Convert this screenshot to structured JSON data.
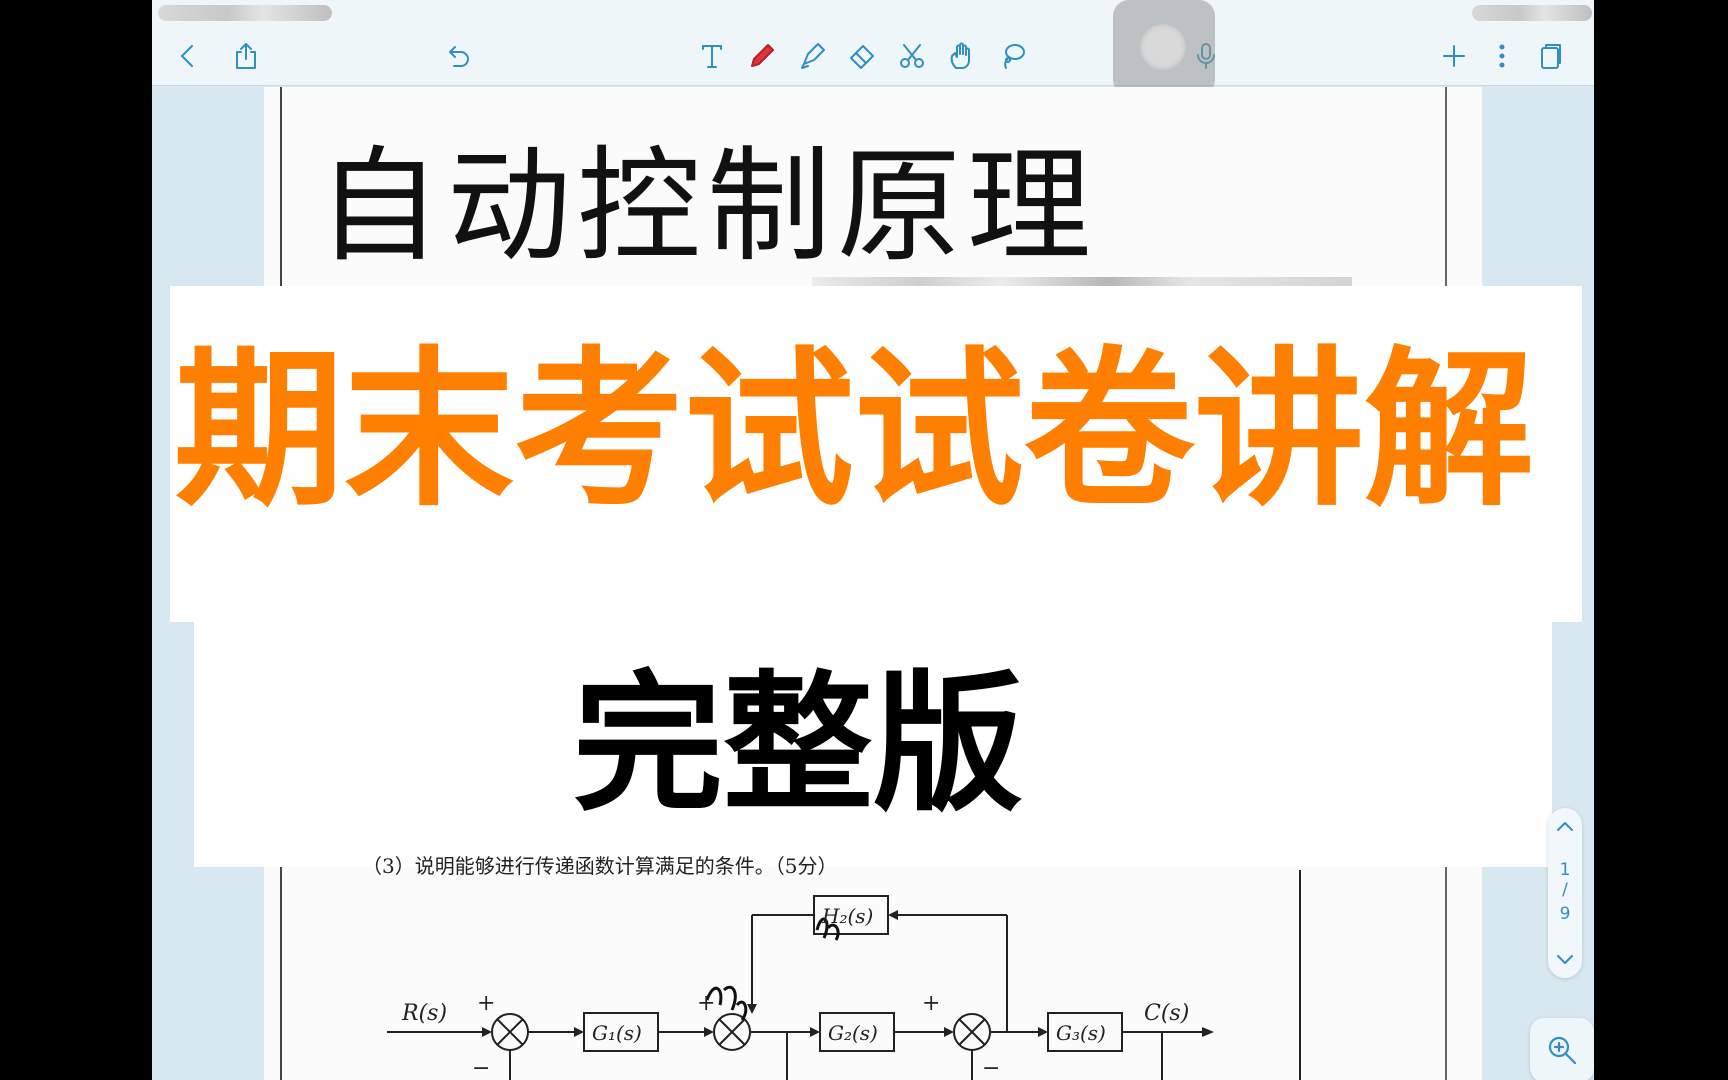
{
  "document": {
    "title": "自动控制原理",
    "question_snippet": "（3）说明能够进行传递函数计算满足的条件。（5分）"
  },
  "overlay": {
    "title": "期末考试试卷讲解",
    "subtitle": "完整版",
    "title_color": "#ff7f00"
  },
  "toolbar": {
    "icons": [
      "back-icon",
      "share-icon",
      "undo-icon",
      "text-tool-icon",
      "pen-icon",
      "highlighter-icon",
      "eraser-icon",
      "scissors-icon",
      "hand-icon",
      "lasso-icon",
      "microphone-icon",
      "add-icon",
      "more-icon",
      "pages-icon"
    ]
  },
  "diagram": {
    "labels": {
      "input": "R(s)",
      "output": "C(s)",
      "g1": "G₁(s)",
      "g2": "G₂(s)",
      "g3": "G₃(s)",
      "h2": "H₂(s)",
      "plus1": "+",
      "plus2": "+",
      "plus3": "+",
      "minus1": "−",
      "minus2": "−"
    }
  },
  "page_nav": {
    "current": "1",
    "separator": "/",
    "total": "9"
  },
  "accent_color": "#2f8fbf"
}
